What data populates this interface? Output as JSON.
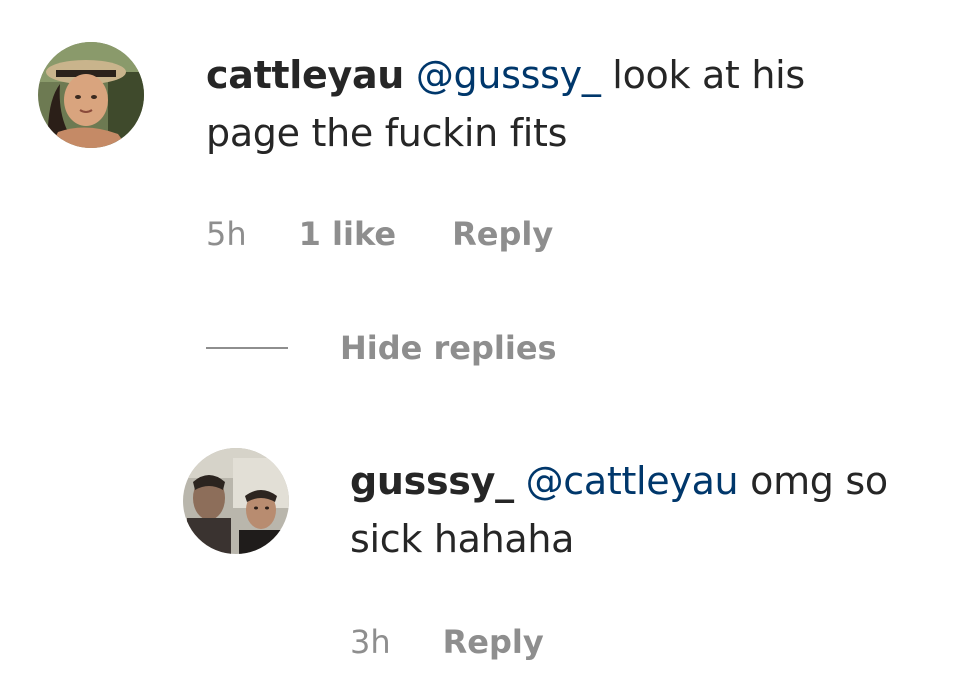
{
  "comments": [
    {
      "username": "cattleyau",
      "mention": "@gusssy_",
      "text_line1": " look at his",
      "text_line2": "page the fuckin fits",
      "time": "5h",
      "likes": "1 like",
      "reply_label": "Reply"
    }
  ],
  "replies_toggle": {
    "label": "Hide replies"
  },
  "replies": [
    {
      "username": "gusssy_",
      "mention": "@cattleyau",
      "text_line1": " omg so",
      "text_line2": "sick hahaha",
      "time": "3h",
      "reply_label": "Reply"
    }
  ],
  "colors": {
    "username": "#262626",
    "mention": "#00376b",
    "meta": "#8e8e8e"
  }
}
